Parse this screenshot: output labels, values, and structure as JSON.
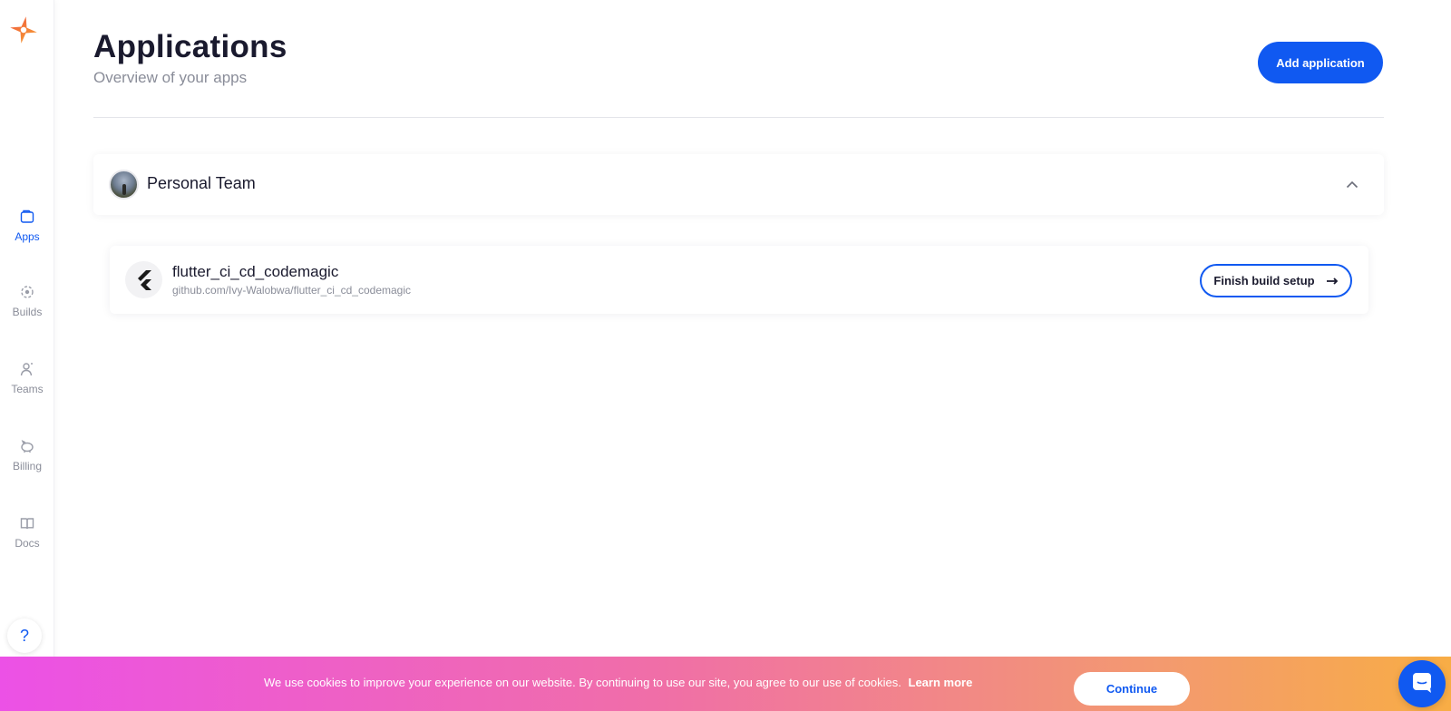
{
  "sidebar": {
    "items": [
      {
        "label": "Apps",
        "icon": "folder-icon",
        "active": true
      },
      {
        "label": "Builds",
        "icon": "builds-icon",
        "active": false
      },
      {
        "label": "Teams",
        "icon": "user-icon",
        "active": false
      },
      {
        "label": "Billing",
        "icon": "piggy-bank-icon",
        "active": false
      },
      {
        "label": "Docs",
        "icon": "book-icon",
        "active": false
      }
    ],
    "help_symbol": "?"
  },
  "header": {
    "title": "Applications",
    "subtitle": "Overview of your apps",
    "add_button_label": "Add application"
  },
  "team": {
    "name": "Personal Team",
    "expanded": true
  },
  "apps": [
    {
      "name": "flutter_ci_cd_codemagic",
      "repo": "github.com/Ivy-Walobwa/flutter_ci_cd_codemagic",
      "action_label": "Finish build setup"
    }
  ],
  "cookie_banner": {
    "text": "We use cookies to improve your experience on our website. By continuing to use our site, you agree to our use of cookies.",
    "learn_more": "Learn more",
    "continue_label": "Continue"
  },
  "colors": {
    "accent": "#1059f1",
    "banner_start": "#ec51e6",
    "banner_end": "#f8ad45"
  }
}
